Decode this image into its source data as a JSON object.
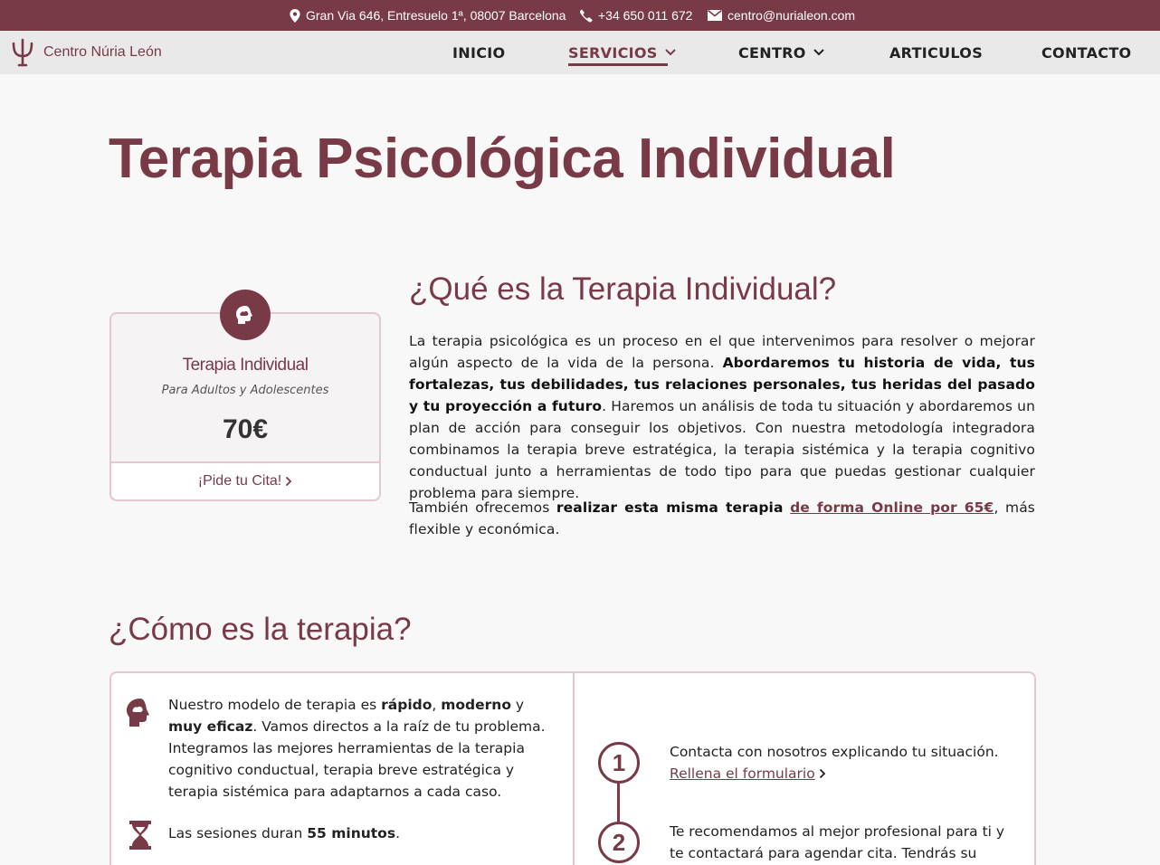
{
  "topbar": {
    "address": "Gran Via 646, Entresuelo 1ª, 08007 Barcelona",
    "phone": "+34 650 011 672",
    "email": "centro@nurialeon.com"
  },
  "brand": {
    "name": "Centro Núria León"
  },
  "nav": {
    "items": [
      {
        "label": "INICIO"
      },
      {
        "label": "SERVICIOS"
      },
      {
        "label": "CENTRO"
      },
      {
        "label": "ARTICULOS"
      },
      {
        "label": "CONTACTO"
      }
    ]
  },
  "page": {
    "title": "Terapia Psicológica Individual"
  },
  "card": {
    "title": "Terapia Individual",
    "subtitle": "Para Adultos y Adolescentes",
    "price": "70€",
    "cta": "¡Pide tu Cita!"
  },
  "section1": {
    "heading": "¿Qué es la Terapia Individual?",
    "p1_a": "La terapia psicológica es un proceso en el que intervenimos para resolver o mejorar algún aspecto de la vida de la persona. ",
    "p1_b": "Abordaremos tu historia de vida, tus fortalezas, tus debilidades, tus relaciones personales, tus heridas del pasado y tu proyección a futuro",
    "p1_c": ". Haremos un análisis de toda tu situación y abordaremos un plan de acción para conseguir los objetivos. Con nuestra metodología integradora combinamos la terapia breve estratégica, la terapia sistémica y la terapia cognitivo conductual junto a herramientas de todo tipo para que puedas gestionar cualquier problema para siempre.",
    "p2_a": "También ofrecemos ",
    "p2_b": "realizar esta misma terapia",
    "p2_link": "de forma Online por 65€",
    "p2_c": ", más flexible y económica."
  },
  "section2": {
    "heading": "¿Cómo es la terapia?",
    "feature1": {
      "a": "Nuestro modelo de terapia es ",
      "b1": "rápido",
      "sep1": ", ",
      "b2": "moderno",
      "sep2": " y ",
      "b3": "muy eficaz",
      "c": ". Vamos directos a la raíz de tu problema. Integramos las mejores herramientas de la terapia cognitivo conductual, terapia breve estratégica y terapia sistémica para adaptarnos a cada caso."
    },
    "feature2": {
      "a": "Las sesiones duran ",
      "b": "55 minutos",
      "c": "."
    },
    "steps": [
      {
        "number": "1",
        "text": "Contacta con nosotros explicando tu situación.",
        "link": "Rellena el formulario"
      },
      {
        "number": "2",
        "text": "Te recomendamos al mejor profesional para ti y te contactará para agendar cita. Tendrás su teléfono y"
      }
    ]
  },
  "colors": {
    "brand": "#793a48",
    "border": "#e3c9cf",
    "navbg": "#e9e9ea"
  }
}
